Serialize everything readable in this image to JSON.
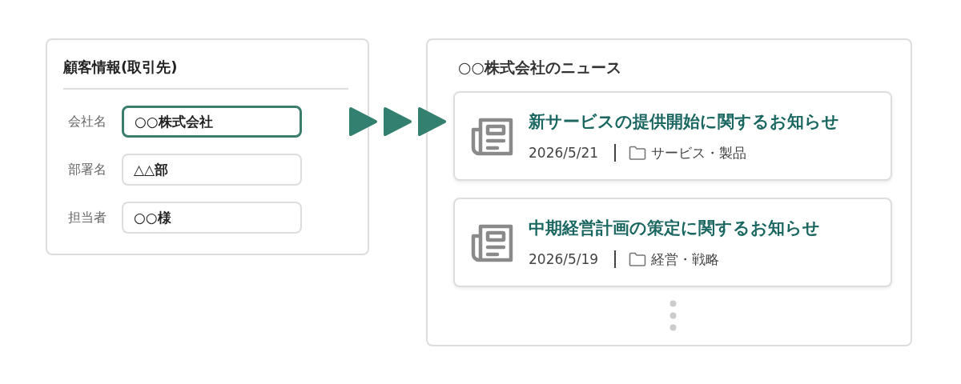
{
  "customer_form": {
    "title": "顧客情報(取引先)",
    "fields": [
      {
        "label": "会社名",
        "value": "○○株式会社",
        "focused": true
      },
      {
        "label": "部署名",
        "value": "△△部",
        "focused": false
      },
      {
        "label": "担当者",
        "value": "○○様",
        "focused": false
      }
    ]
  },
  "news_panel": {
    "title": "○○株式会社のニュース",
    "items": [
      {
        "title": "新サービスの提供開始に関するお知らせ",
        "date": "2026/5/21",
        "category": "サービス・製品"
      },
      {
        "title": "中期経営計画の策定に関するお知らせ",
        "date": "2026/5/19",
        "category": "経営・戦略"
      }
    ]
  }
}
